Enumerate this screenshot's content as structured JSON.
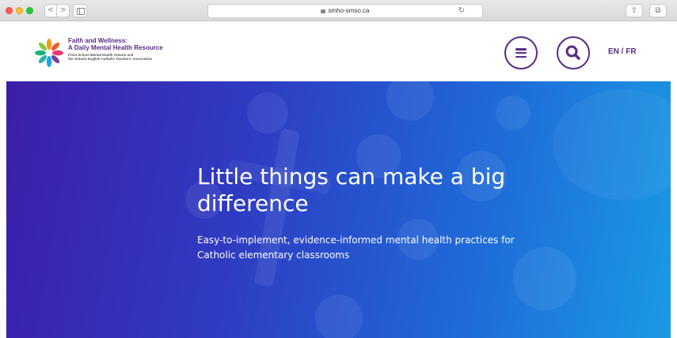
{
  "browser": {
    "url": "smho-smso.ca",
    "back_glyph": "<",
    "forward_glyph": ">",
    "reload_glyph": "↻",
    "share_glyph": "⇧",
    "tabs_glyph": "⧉"
  },
  "header": {
    "logo_line1": "Faith and Wellness:",
    "logo_line2": "A Daily Mental Health Resource",
    "logo_sub1": "From School Mental Health Ontario and",
    "logo_sub2": "the Ontario English Catholic Teachers' Association",
    "language_toggle": "EN / FR",
    "menu_icon": "hamburger-menu-icon",
    "search_icon": "magnifier-search-icon"
  },
  "hero": {
    "title": "Little things can make a big difference",
    "subtitle": "Easy-to-implement, evidence-informed mental health practices for Catholic elementary classrooms"
  },
  "colors": {
    "brand_purple": "#5b2a86",
    "hero_start": "#3d1ea8",
    "hero_end": "#1a9be3"
  }
}
